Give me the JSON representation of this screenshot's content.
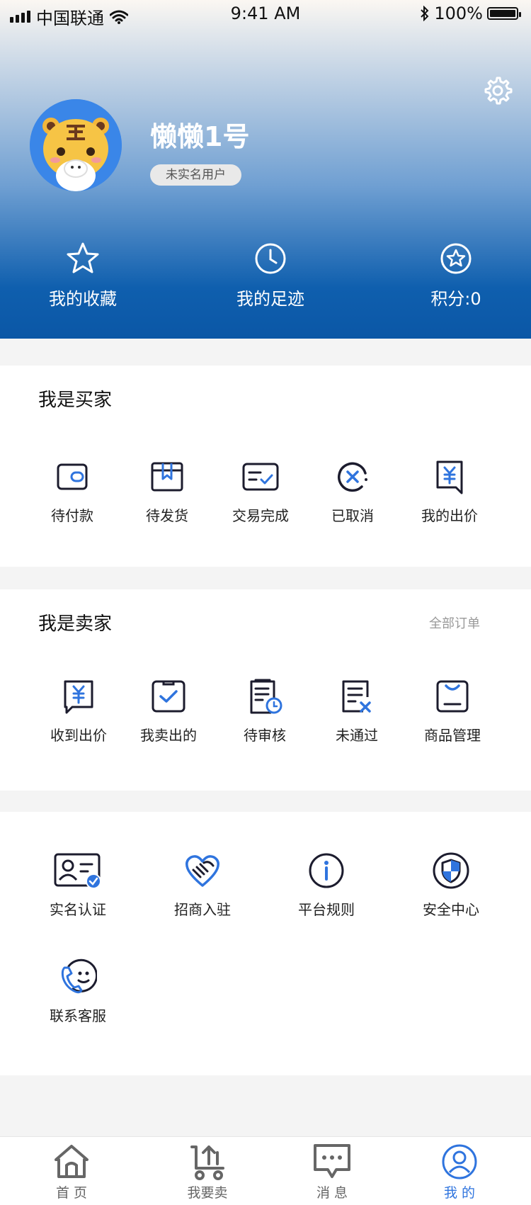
{
  "status_bar": {
    "carrier": "中国联通",
    "time": "9:41 AM",
    "battery": "100%"
  },
  "profile": {
    "username": "懒懒1号",
    "badge": "未实名用户",
    "settings_icon": "gear-icon",
    "avatar_icon": "tiger-avatar"
  },
  "header_stats": [
    {
      "icon": "star-icon",
      "label": "我的收藏"
    },
    {
      "icon": "clock-icon",
      "label": "我的足迹"
    },
    {
      "icon": "star-circle-icon",
      "label": "积分:0"
    }
  ],
  "buyer": {
    "title": "我是买家",
    "items": [
      {
        "icon": "wallet-icon",
        "label": "待付款"
      },
      {
        "icon": "package-icon",
        "label": "待发货"
      },
      {
        "icon": "completed-icon",
        "label": "交易完成"
      },
      {
        "icon": "cancelled-icon",
        "label": "已取消"
      },
      {
        "icon": "yuan-offer-icon",
        "label": "我的出价"
      }
    ]
  },
  "seller": {
    "title": "我是卖家",
    "link": "全部订单",
    "items": [
      {
        "icon": "yuan-received-icon",
        "label": "收到出价"
      },
      {
        "icon": "sold-icon",
        "label": "我卖出的"
      },
      {
        "icon": "pending-review-icon",
        "label": "待审核"
      },
      {
        "icon": "rejected-icon",
        "label": "未通过"
      },
      {
        "icon": "goods-manage-icon",
        "label": "商品管理"
      }
    ]
  },
  "services": {
    "items": [
      {
        "icon": "id-verify-icon",
        "label": "实名认证"
      },
      {
        "icon": "handshake-icon",
        "label": "招商入驻"
      },
      {
        "icon": "info-icon",
        "label": "平台规则"
      },
      {
        "icon": "shield-icon",
        "label": "安全中心"
      },
      {
        "icon": "phone-service-icon",
        "label": "联系客服"
      }
    ]
  },
  "tabbar": [
    {
      "icon": "home-icon",
      "label": "首 页",
      "active": false
    },
    {
      "icon": "sell-icon",
      "label": "我要卖",
      "active": false
    },
    {
      "icon": "message-icon",
      "label": "消 息",
      "active": false
    },
    {
      "icon": "user-icon",
      "label": "我 的",
      "active": true
    }
  ],
  "colors": {
    "accent": "#2f74de",
    "header_bottom": "#0b57a6",
    "text": "#222222"
  }
}
